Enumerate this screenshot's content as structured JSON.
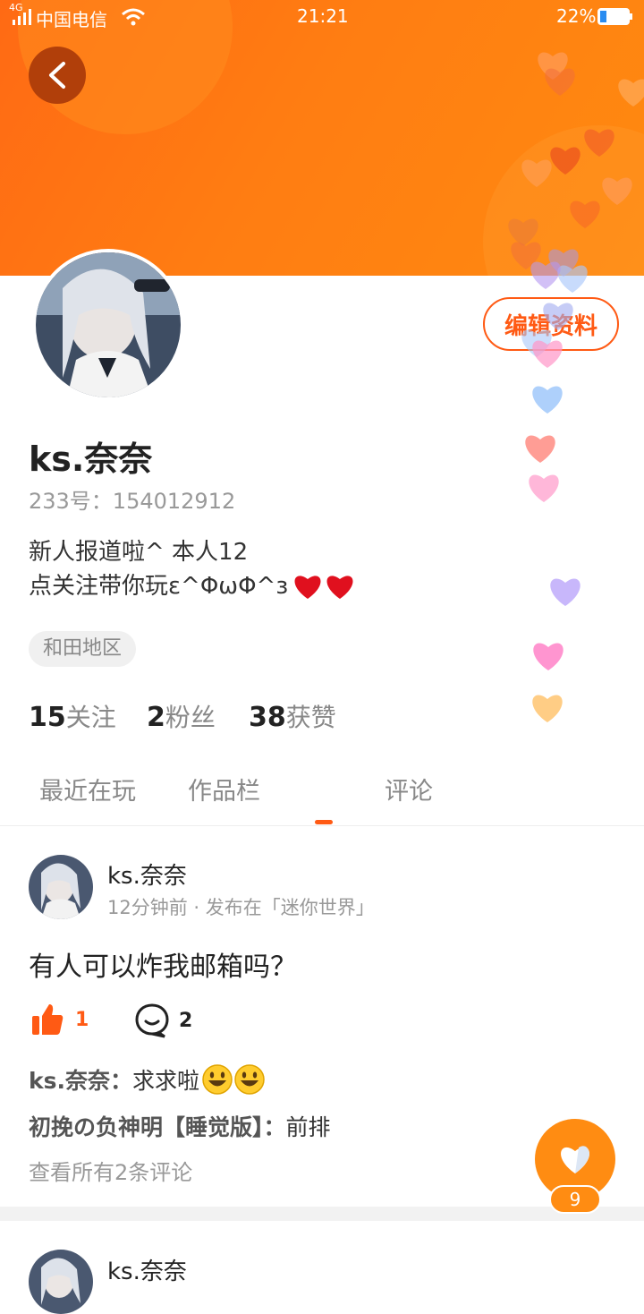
{
  "status_bar": {
    "network": "4G",
    "carrier": "中国电信",
    "time": "21:21",
    "battery": "22%"
  },
  "profile": {
    "name": "ks.奈奈",
    "uid": "233号：154012912",
    "bio_line1": "新人报道啦^   本人12",
    "bio_line2": "点关注带你玩ε^ΦωΦ^з",
    "region": "和田地区",
    "edit_label": "编辑资料"
  },
  "stats": {
    "following_count": "15",
    "following_label": "关注",
    "fans_count": "2",
    "fans_label": "粉丝",
    "likes_count": "38",
    "likes_label": "获赞"
  },
  "tabs": [
    "最近在玩",
    "作品栏",
    "评论"
  ],
  "active_tab": "评论",
  "post": {
    "author": "ks.奈奈",
    "meta": "12分钟前 · 发布在「迷你世界」",
    "text": "有人可以炸我邮箱吗？",
    "likes": "1",
    "comments": "2",
    "comment_list": [
      {
        "who": "ks.奈奈：",
        "text": "求求啦"
      },
      {
        "who": "初挽の负神明【睡觉版】：",
        "text": "前排"
      }
    ],
    "view_all": "查看所有2条评论"
  },
  "post2": {
    "author": "ks.奈奈"
  },
  "fab": {
    "badge": "9"
  },
  "colors": {
    "accent": "#ff5a14",
    "banner": "#ff7a12",
    "fab": "#ff8c12"
  },
  "icons": [
    "back-icon",
    "signal-icon",
    "wifi-icon",
    "battery-icon",
    "thumb-up-icon",
    "comment-icon",
    "heart-icon"
  ]
}
